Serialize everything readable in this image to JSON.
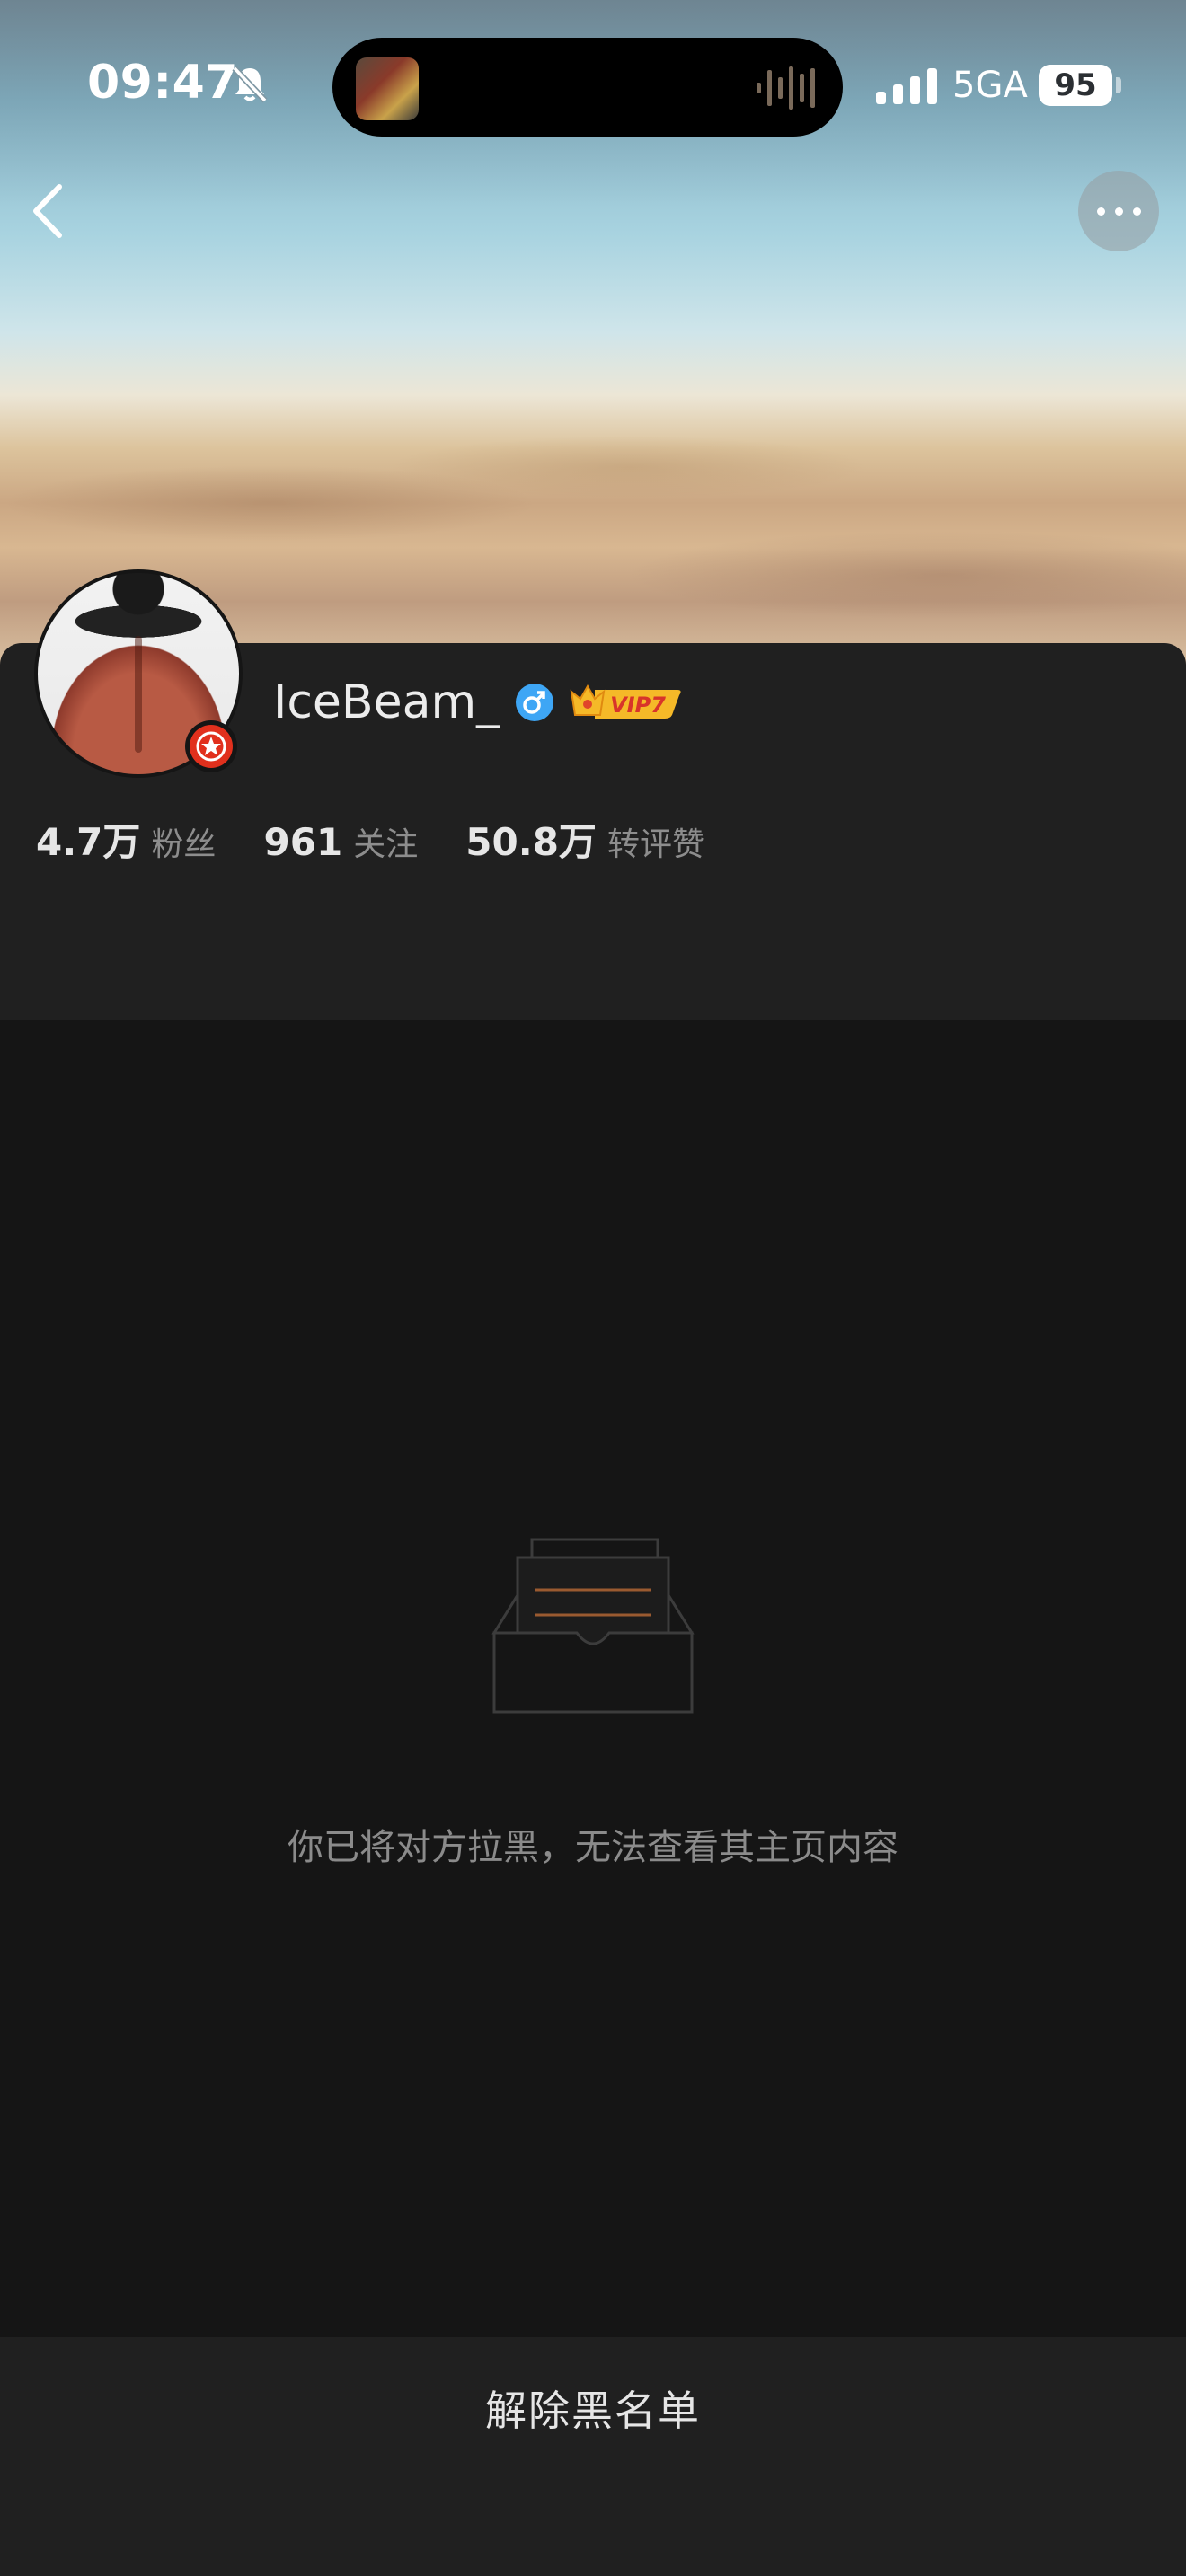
{
  "status_bar": {
    "time": "09:47",
    "network": "5GA",
    "battery": "95"
  },
  "nav": {
    "back_icon": "chevron-left-icon",
    "more_icon": "ellipsis-icon"
  },
  "profile": {
    "username": "IceBeam_",
    "gender_icon": "male-icon",
    "vip_label": "VIP7",
    "stats": [
      {
        "value": "4.7万",
        "label": "粉丝"
      },
      {
        "value": "961",
        "label": "关注"
      },
      {
        "value": "50.8万",
        "label": "转评赞"
      }
    ]
  },
  "empty_state": {
    "icon": "empty-box-icon",
    "message": "你已将对方拉黑，无法查看其主页内容"
  },
  "bottom_action": {
    "unblock_label": "解除黑名单"
  },
  "colors": {
    "background": "#151515",
    "card": "#202020",
    "accent_red": "#e1301d",
    "gender_blue": "#3ea6f5",
    "vip_gold": "#f5b928"
  }
}
